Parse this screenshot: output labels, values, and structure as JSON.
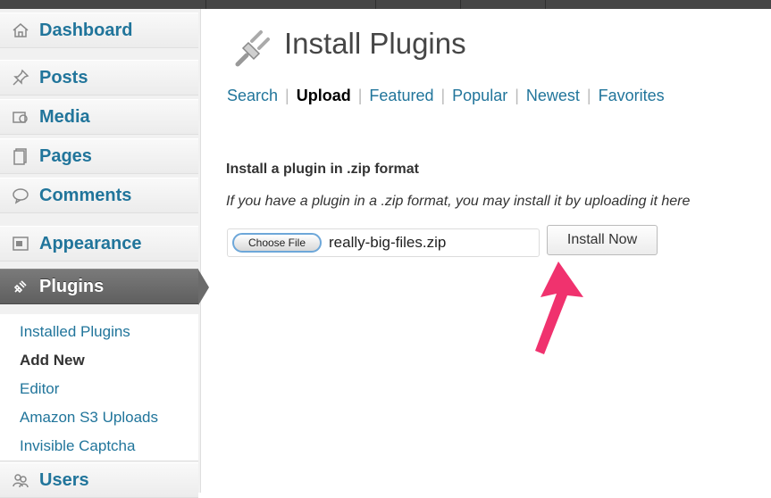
{
  "sidebar": {
    "menu": [
      {
        "label": "Dashboard",
        "icon": "dashboard-icon"
      },
      {
        "label": "Posts",
        "icon": "pushpin-icon"
      },
      {
        "label": "Media",
        "icon": "media-icon"
      },
      {
        "label": "Pages",
        "icon": "pages-icon"
      },
      {
        "label": "Comments",
        "icon": "comment-icon"
      },
      {
        "label": "Appearance",
        "icon": "appearance-icon"
      },
      {
        "label": "Plugins",
        "icon": "plugin-icon"
      },
      {
        "label": "Users",
        "icon": "users-icon"
      }
    ],
    "plugins_submenu": [
      {
        "label": "Installed Plugins"
      },
      {
        "label": "Add New"
      },
      {
        "label": "Editor"
      },
      {
        "label": "Amazon S3 Uploads"
      },
      {
        "label": "Invisible Captcha"
      }
    ]
  },
  "page": {
    "title": "Install Plugins",
    "icon": "plug-icon"
  },
  "tabs": [
    {
      "label": "Search"
    },
    {
      "label": "Upload"
    },
    {
      "label": "Featured"
    },
    {
      "label": "Popular"
    },
    {
      "label": "Newest"
    },
    {
      "label": "Favorites"
    }
  ],
  "tab_separator": "|",
  "upload": {
    "heading": "Install a plugin in .zip format",
    "help_text": "If you have a plugin in a .zip format, you may install it by uploading it here",
    "choose_file_label": "Choose File",
    "file_name": "really-big-files.zip",
    "install_button_label": "Install Now"
  },
  "colors": {
    "link": "#21759b",
    "active_menu_bg": "#6b6b6b",
    "annotation_arrow": "#f0326e"
  }
}
